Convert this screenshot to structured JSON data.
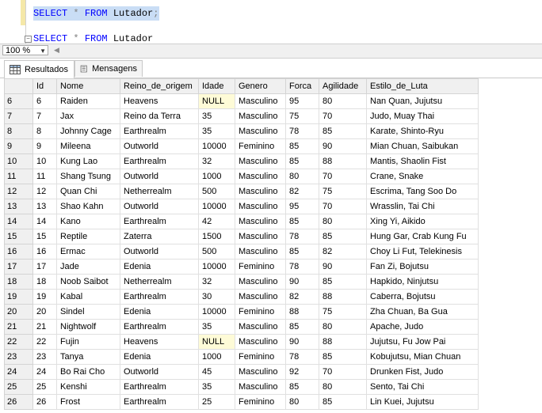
{
  "editor": {
    "line1": {
      "kw1": "SELECT",
      "op": " * ",
      "kw2": "FROM",
      "table": " Lutador",
      "semi": ";"
    },
    "line2": {
      "kw1": "SELECT",
      "op": " * ",
      "kw2": "FROM",
      "table": " Lutador"
    },
    "fold_glyph": "−"
  },
  "zoom": {
    "value": "100 %",
    "arrow": "▼",
    "scroll_left": "◀"
  },
  "tabs": [
    {
      "label": "Resultados",
      "icon": "grid-icon",
      "active": true
    },
    {
      "label": "Mensagens",
      "icon": "messages-icon",
      "active": false
    }
  ],
  "grid": {
    "columns": [
      "Id",
      "Nome",
      "Reino_de_origem",
      "Idade",
      "Genero",
      "Forca",
      "Agilidade",
      "Estilo_de_Luta"
    ],
    "rows": [
      {
        "row": "6",
        "cells": [
          "6",
          "Raiden",
          "Heavens",
          "NULL",
          "Masculino",
          "95",
          "80",
          "Nan Quan, Jujutsu"
        ]
      },
      {
        "row": "7",
        "cells": [
          "7",
          "Jax",
          "Reino da Terra",
          "35",
          "Masculino",
          "75",
          "70",
          "Judo, Muay Thai"
        ]
      },
      {
        "row": "8",
        "cells": [
          "8",
          "Johnny Cage",
          "Earthrealm",
          "35",
          "Masculino",
          "78",
          "85",
          "Karate, Shinto-Ryu"
        ]
      },
      {
        "row": "9",
        "cells": [
          "9",
          "Mileena",
          "Outworld",
          "10000",
          "Feminino",
          "85",
          "90",
          "Mian Chuan, Saibukan"
        ]
      },
      {
        "row": "10",
        "cells": [
          "10",
          "Kung Lao",
          "Earthrealm",
          "32",
          "Masculino",
          "85",
          "88",
          "Mantis, Shaolin Fist"
        ]
      },
      {
        "row": "11",
        "cells": [
          "11",
          "Shang Tsung",
          "Outworld",
          "1000",
          "Masculino",
          "80",
          "70",
          "Crane, Snake"
        ]
      },
      {
        "row": "12",
        "cells": [
          "12",
          "Quan Chi",
          "Netherrealm",
          "500",
          "Masculino",
          "82",
          "75",
          "Escrima, Tang Soo Do"
        ]
      },
      {
        "row": "13",
        "cells": [
          "13",
          "Shao Kahn",
          "Outworld",
          "10000",
          "Masculino",
          "95",
          "70",
          "Wrasslin, Tai Chi"
        ]
      },
      {
        "row": "14",
        "cells": [
          "14",
          "Kano",
          "Earthrealm",
          "42",
          "Masculino",
          "85",
          "80",
          "Xing Yi, Aikido"
        ]
      },
      {
        "row": "15",
        "cells": [
          "15",
          "Reptile",
          "Zaterra",
          "1500",
          "Masculino",
          "78",
          "85",
          "Hung Gar, Crab Kung Fu"
        ]
      },
      {
        "row": "16",
        "cells": [
          "16",
          "Ermac",
          "Outworld",
          "500",
          "Masculino",
          "85",
          "82",
          "Choy Li Fut, Telekinesis"
        ]
      },
      {
        "row": "17",
        "cells": [
          "17",
          "Jade",
          "Edenia",
          "10000",
          "Feminino",
          "78",
          "90",
          "Fan Zi, Bojutsu"
        ]
      },
      {
        "row": "18",
        "cells": [
          "18",
          "Noob Saibot",
          "Netherrealm",
          "32",
          "Masculino",
          "90",
          "85",
          "Hapkido, Ninjutsu"
        ]
      },
      {
        "row": "19",
        "cells": [
          "19",
          "Kabal",
          "Earthrealm",
          "30",
          "Masculino",
          "82",
          "88",
          "Caberra, Bojutsu"
        ]
      },
      {
        "row": "20",
        "cells": [
          "20",
          "Sindel",
          "Edenia",
          "10000",
          "Feminino",
          "88",
          "75",
          "Zha Chuan, Ba Gua"
        ]
      },
      {
        "row": "21",
        "cells": [
          "21",
          "Nightwolf",
          "Earthrealm",
          "35",
          "Masculino",
          "85",
          "80",
          "Apache, Judo"
        ]
      },
      {
        "row": "22",
        "cells": [
          "22",
          "Fujin",
          "Heavens",
          "NULL",
          "Masculino",
          "90",
          "88",
          "Jujutsu, Fu Jow Pai"
        ]
      },
      {
        "row": "23",
        "cells": [
          "23",
          "Tanya",
          "Edenia",
          "1000",
          "Feminino",
          "78",
          "85",
          "Kobujutsu, Mian Chuan"
        ]
      },
      {
        "row": "24",
        "cells": [
          "24",
          "Bo Rai Cho",
          "Outworld",
          "45",
          "Masculino",
          "92",
          "70",
          "Drunken Fist, Judo"
        ]
      },
      {
        "row": "25",
        "cells": [
          "25",
          "Kenshi",
          "Earthrealm",
          "35",
          "Masculino",
          "85",
          "80",
          "Sento, Tai Chi"
        ]
      },
      {
        "row": "26",
        "cells": [
          "26",
          "Frost",
          "Earthrealm",
          "25",
          "Feminino",
          "80",
          "85",
          "Lin Kuei, Jujutsu"
        ]
      }
    ]
  },
  "colors": {
    "keyword": "#0000ff",
    "selection": "#c9ddf5",
    "null_cell": "#fefbd7",
    "header_bg": "#f0f0f0"
  }
}
